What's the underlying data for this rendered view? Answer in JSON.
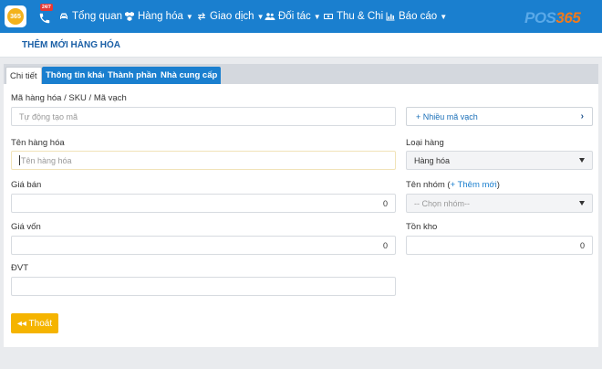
{
  "nav": {
    "badge": "24/7",
    "items": [
      {
        "label": "Tổng quan",
        "icon": "car-icon"
      },
      {
        "label": "Hàng hóa",
        "icon": "cubes-icon"
      },
      {
        "label": "Giao dịch",
        "icon": "exchange-icon"
      },
      {
        "label": "Đối tác",
        "icon": "users-icon"
      },
      {
        "label": "Thu & Chi",
        "icon": "money-icon"
      },
      {
        "label": "Báo cáo",
        "icon": "bar-chart-icon"
      }
    ],
    "brand_a": "POS",
    "brand_b": "365"
  },
  "page": {
    "title": "THÊM MỚI HÀNG HÓA"
  },
  "tabs": [
    "Chi tiết",
    "Thông tin khác",
    "Thành phần",
    "Nhà cung cấp"
  ],
  "form": {
    "sku_label": "Mã hàng hóa / SKU / Mã vạch",
    "sku_placeholder": "Tự động tạo mã",
    "multi_barcode": "+ Nhiều mã vạch",
    "name_label": "Tên hàng hóa",
    "name_placeholder": "Tên hàng hóa",
    "type_label": "Loại hàng",
    "type_value": "Hàng hóa",
    "price_label": "Giá bán",
    "price_value": "0",
    "group_label_prefix": "Tên nhóm (",
    "group_add": "+ Thêm mới",
    "group_label_suffix": ")",
    "group_placeholder": "-- Chọn nhóm--",
    "cost_label": "Giá vốn",
    "cost_value": "0",
    "stock_label": "Tồn kho",
    "stock_value": "0",
    "unit_label": "ĐVT",
    "unit_value": ""
  },
  "exit_label": "◂◂ Thoát",
  "colors": {
    "primary": "#1a7fcf",
    "warning": "#f5b400"
  }
}
